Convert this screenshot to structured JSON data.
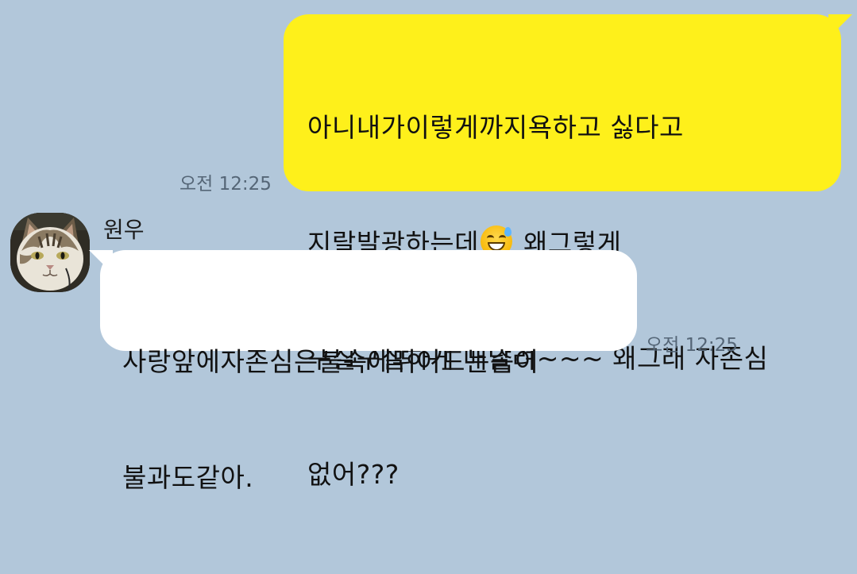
{
  "colors": {
    "background": "#b2c7da",
    "sent_bubble": "#fef01b",
    "received_bubble": "#ffffff",
    "time_text": "#556677"
  },
  "messages": [
    {
      "direction": "sent",
      "lines": [
        "아니내가이렇게까지욕하고 싫다고",
        "지랄발광하는데",
        " 왜그렇게",
        "구질구질하게 매달려~~~ 왜그래 자존심",
        "없어???"
      ],
      "emoji": "grinning-face-with-sweat",
      "time": "오전 12:25"
    },
    {
      "direction": "received",
      "sender": "원우",
      "avatar": "cat-avatar",
      "lines": [
        "사랑앞에자존심은불속에뛰어드는솜이",
        "불과도같아."
      ],
      "time": "오전 12:25"
    }
  ]
}
